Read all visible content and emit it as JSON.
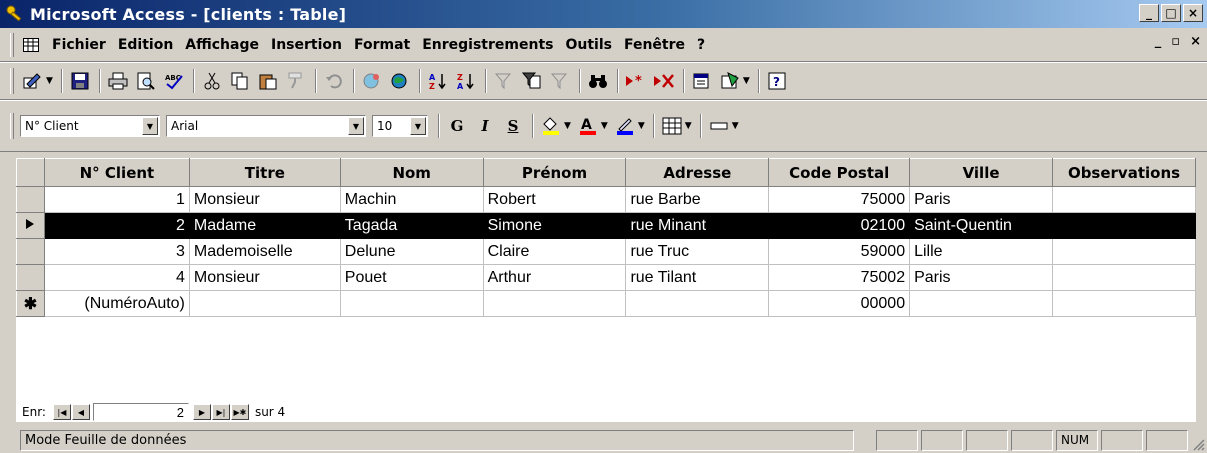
{
  "window": {
    "title": "Microsoft Access - [clients : Table]",
    "controls": [
      "_",
      "□",
      "×"
    ]
  },
  "menubar": {
    "items": [
      {
        "label": "Fichier"
      },
      {
        "label": "Edition"
      },
      {
        "label": "Affichage"
      },
      {
        "label": "Insertion"
      },
      {
        "label": "Format"
      },
      {
        "label": "Enregistrements"
      },
      {
        "label": "Outils"
      },
      {
        "label": "Fenêtre"
      },
      {
        "label": "?"
      }
    ],
    "doc_controls": [
      "_",
      "▫",
      "×"
    ]
  },
  "toolbar": {
    "buttons": [
      "view",
      "save",
      "print",
      "print-preview",
      "spelling",
      "cut",
      "copy",
      "paste",
      "format-painter",
      "undo",
      "hyperlink",
      "web",
      "sort-asc",
      "sort-desc",
      "filter-selection",
      "filter-form",
      "apply-filter",
      "find",
      "new-record",
      "delete-record",
      "properties",
      "database-window",
      "help"
    ]
  },
  "format_toolbar": {
    "field_select": "N° Client",
    "font": "Arial",
    "size": "10",
    "bold": "G",
    "italic": "I",
    "underline": "S"
  },
  "colors": {
    "fill": "#ffff00",
    "font": "#ff0000",
    "border": "#0000ff"
  },
  "table": {
    "columns": [
      "N° Client",
      "Titre",
      "Nom",
      "Prénom",
      "Adresse",
      "Code Postal",
      "Ville",
      "Observations"
    ],
    "rows": [
      {
        "id": "1",
        "titre": "Monsieur",
        "nom": "Machin",
        "prenom": "Robert",
        "adresse": "rue Barbe",
        "cp": "75000",
        "ville": "Paris",
        "obs": ""
      },
      {
        "id": "2",
        "titre": "Madame",
        "nom": "Tagada",
        "prenom": "Simone",
        "adresse": "rue Minant",
        "cp": "02100",
        "ville": "Saint-Quentin",
        "obs": ""
      },
      {
        "id": "3",
        "titre": "Mademoiselle",
        "nom": "Delune",
        "prenom": "Claire",
        "adresse": "rue Truc",
        "cp": "59000",
        "ville": "Lille",
        "obs": ""
      },
      {
        "id": "4",
        "titre": "Monsieur",
        "nom": "Pouet",
        "prenom": "Arthur",
        "adresse": "rue Tilant",
        "cp": "75002",
        "ville": "Paris",
        "obs": ""
      }
    ],
    "new_row": {
      "id": "(NuméroAuto)",
      "cp": "00000"
    },
    "current_row": 2
  },
  "navigation": {
    "label": "Enr:",
    "current": "2",
    "total_label": "sur 4"
  },
  "status": {
    "text": "Mode Feuille de données",
    "num": "NUM"
  }
}
